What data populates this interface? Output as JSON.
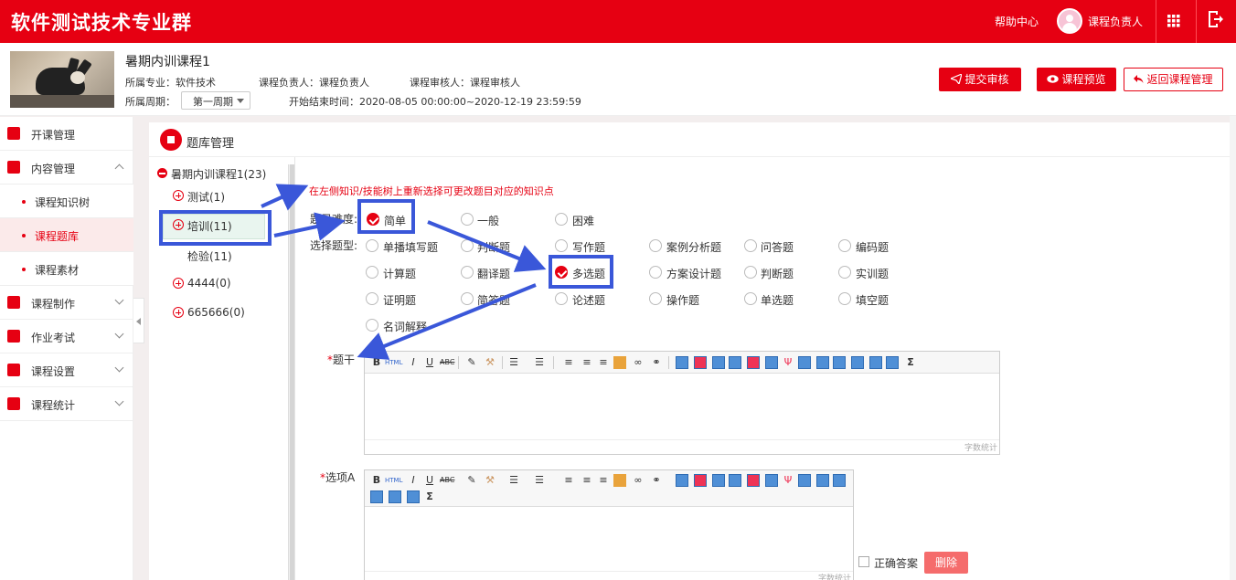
{
  "app": {
    "title": "软件测试技术专业群",
    "help": "帮助中心",
    "user": "课程负责人"
  },
  "course": {
    "title": "暑期内训课程1",
    "major_label": "所属专业：软件技术",
    "owner_label": "课程负责人：课程负责人",
    "reviewer_label": "课程审核人：课程审核人",
    "period_label": "所属周期：",
    "period_value": "第一周期",
    "time_label": "开始结束时间：2020-08-05 00:00:00~2020-12-19 23:59:59"
  },
  "actions": {
    "submit": "提交审核",
    "preview": "课程预览",
    "back": "返回课程管理"
  },
  "sidebar": {
    "items": [
      {
        "label": "开课管理"
      },
      {
        "label": "内容管理"
      },
      {
        "label": "课程制作"
      },
      {
        "label": "作业考试"
      },
      {
        "label": "课程设置"
      },
      {
        "label": "课程统计"
      }
    ],
    "subitems": [
      {
        "label": "课程知识树"
      },
      {
        "label": "课程题库"
      },
      {
        "label": "课程素材"
      }
    ]
  },
  "panel": {
    "title": "题库管理"
  },
  "tree": {
    "root": "暑期内训课程1(23)",
    "nodes": [
      {
        "label": "测试(1)"
      },
      {
        "label": "培训(11)"
      },
      {
        "label": "检验(11)"
      },
      {
        "label": "4444(0)"
      },
      {
        "label": "665666(0)"
      }
    ]
  },
  "form": {
    "hint": "在左侧知识/技能树上重新选择可更改题目对应的知识点",
    "difficulty_label": "题目难度:",
    "difficulty": [
      {
        "label": "简单",
        "checked": true
      },
      {
        "label": "一般",
        "checked": false
      },
      {
        "label": "困难",
        "checked": false
      }
    ],
    "type_label": "选择题型:",
    "types": [
      {
        "label": "单播填写题"
      },
      {
        "label": "判断题"
      },
      {
        "label": "写作题"
      },
      {
        "label": "案例分析题"
      },
      {
        "label": "问答题"
      },
      {
        "label": "编码题"
      },
      {
        "label": "计算题"
      },
      {
        "label": "翻译题"
      },
      {
        "label": "多选题"
      },
      {
        "label": "方案设计题"
      },
      {
        "label": "判断题"
      },
      {
        "label": "实训题"
      },
      {
        "label": "证明题"
      },
      {
        "label": "简答题"
      },
      {
        "label": "论述题"
      },
      {
        "label": "操作题"
      },
      {
        "label": "单选题"
      },
      {
        "label": "填空题"
      },
      {
        "label": "名词解释"
      }
    ],
    "selected_type": "多选题",
    "stem_label": "题干",
    "option_label": "选项A",
    "counter": "字数统计",
    "correct_label": "正确答案",
    "delete": "删除"
  },
  "colors": {
    "brand": "#e60012",
    "annotation": "#3a57d9"
  }
}
